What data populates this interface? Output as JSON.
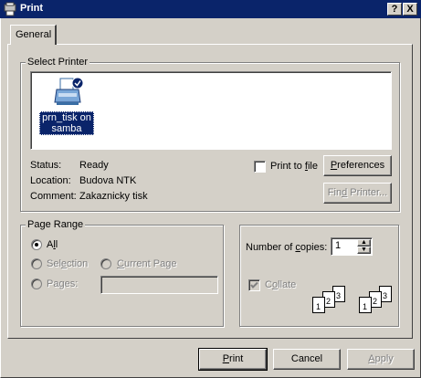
{
  "window": {
    "title": "Print",
    "help_btn": "?",
    "close_btn": "X"
  },
  "tabs": [
    {
      "label": "General"
    }
  ],
  "select_printer": {
    "legend": "Select Printer",
    "printer": {
      "name_line1": "prn_tisk on",
      "name_line2": "samba"
    },
    "status_label": "Status:",
    "status_value": "Ready",
    "location_label": "Location:",
    "location_value": "Budova NTK",
    "comment_label": "Comment:",
    "comment_value": "Zakaznicky tisk",
    "print_to_file_pre": "Print to ",
    "print_to_file_u": "f",
    "print_to_file_post": "ile",
    "print_to_file_checked": false,
    "preferences_u": "P",
    "preferences_rest": "references",
    "find_printer_pre": "Fin",
    "find_printer_u": "d",
    "find_printer_post": " Printer..."
  },
  "page_range": {
    "legend": "Page Range",
    "all_pre": "A",
    "all_u": "l",
    "all_post": "l",
    "all_checked": true,
    "selection_pre": "Sel",
    "selection_u": "e",
    "selection_post": "ction",
    "current_page_u": "C",
    "current_page_rest": "urrent Page",
    "pages_pre": "Pa",
    "pages_u": "g",
    "pages_post": "es:",
    "pages_value": ""
  },
  "copies": {
    "number_label_pre": "Number of ",
    "number_label_u": "c",
    "number_label_post": "opies:",
    "value": "1",
    "collate_pre": "C",
    "collate_u": "o",
    "collate_post": "llate",
    "collate_checked": true,
    "collate_pages": [
      "1",
      "2",
      "3",
      "1",
      "2",
      "3"
    ]
  },
  "footer": {
    "print_u": "P",
    "print_rest": "rint",
    "cancel": "Cancel",
    "apply_u": "A",
    "apply_rest": "pply"
  },
  "colors": {
    "title_bg": "#0a246a",
    "face": "#d4d0c8",
    "selection": "#0a246a"
  },
  "icons": [
    "windows-logo-icon",
    "printer-icon",
    "default-check-icon",
    "spinner-up-icon",
    "spinner-down-icon"
  ]
}
